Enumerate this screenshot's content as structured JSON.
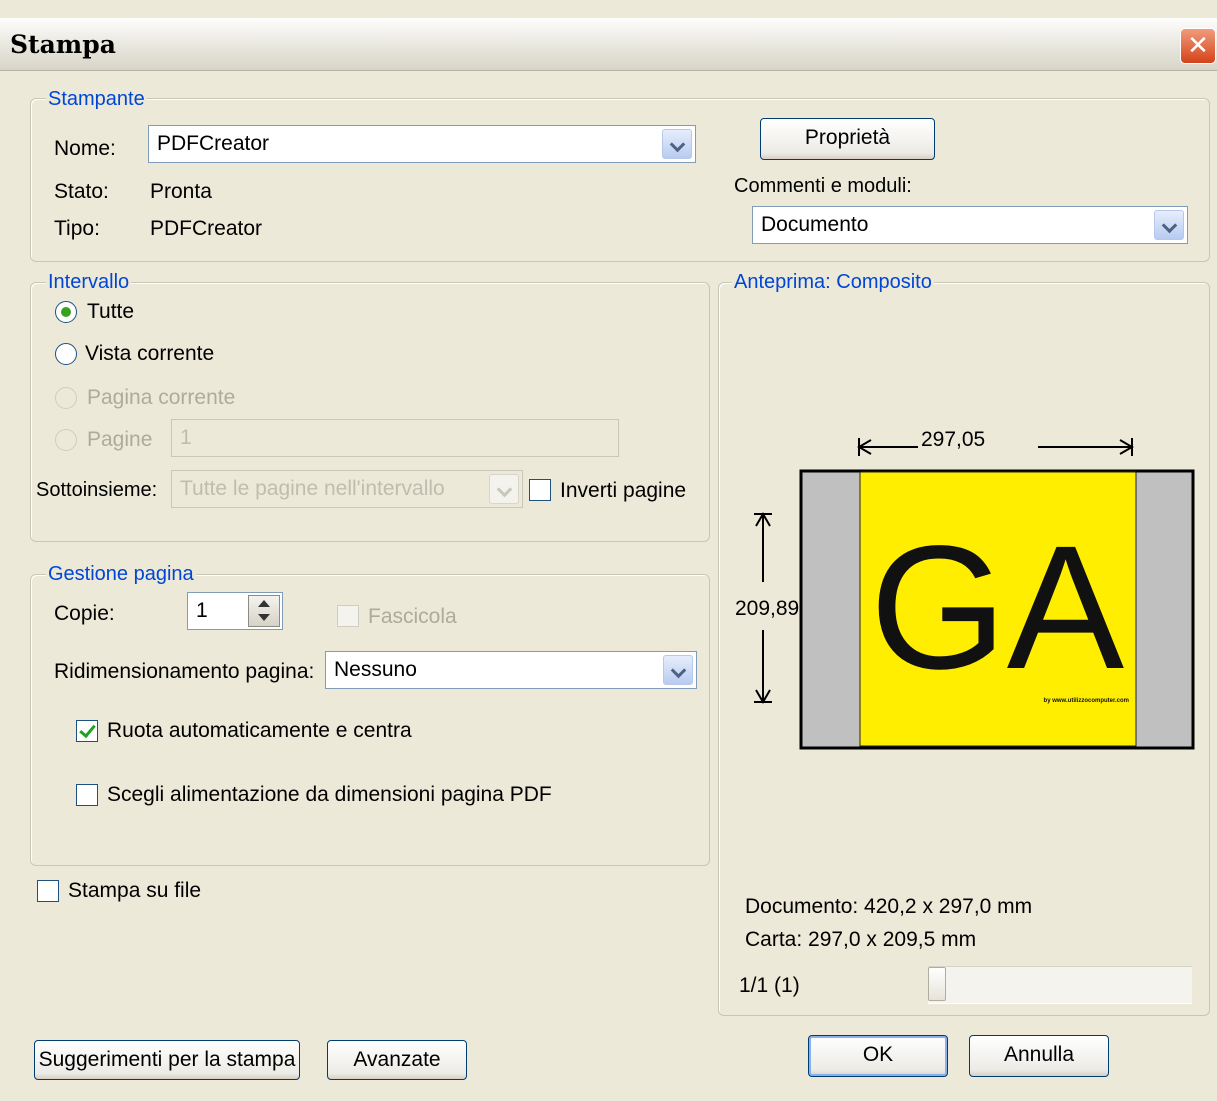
{
  "window": {
    "title": "Stampa",
    "close_icon": "close-icon"
  },
  "printer": {
    "group_label": "Stampante",
    "name_label": "Nome:",
    "name_value": "PDFCreator",
    "status_label": "Stato:",
    "status_value": "Pronta",
    "type_label": "Tipo:",
    "type_value": "PDFCreator",
    "properties_button": "Proprietà",
    "comments_label": "Commenti e moduli:",
    "comments_value": "Documento"
  },
  "range": {
    "group_label": "Intervallo",
    "all": "Tutte",
    "current_view": "Vista corrente",
    "current_page": "Pagina corrente",
    "pages": "Pagine",
    "pages_value": "1",
    "subset_label": "Sottoinsieme:",
    "subset_value": "Tutte le pagine nell'intervallo",
    "reverse_pages": "Inverti pagine"
  },
  "page_handling": {
    "group_label": "Gestione pagina",
    "copies_label": "Copie:",
    "copies_value": "1",
    "collate": "Fascicola",
    "scaling_label": "Ridimensionamento pagina:",
    "scaling_value": "Nessuno",
    "auto_rotate": "Ruota automaticamente e centra",
    "auto_rotate_checked": true,
    "choose_source": "Scegli alimentazione da dimensioni pagina PDF",
    "choose_source_checked": false
  },
  "print_to_file": {
    "label": "Stampa su file",
    "checked": false
  },
  "preview": {
    "group_label": "Anteprima: Composito",
    "width_value": "297,05",
    "height_value": "209,89",
    "preview_text": "GA",
    "preview_small_text": "by www.utilizzocomputer.com",
    "preview_color": "#ffee00",
    "document_info": "Documento: 420,2 x 297,0 mm",
    "paper_info": "Carta: 297,0 x 209,5 mm",
    "page_counter": "1/1 (1)",
    "slider_position": 0
  },
  "buttons": {
    "tips": "Suggerimenti per la stampa",
    "advanced": "Avanzate",
    "ok": "OK",
    "cancel": "Annulla"
  }
}
